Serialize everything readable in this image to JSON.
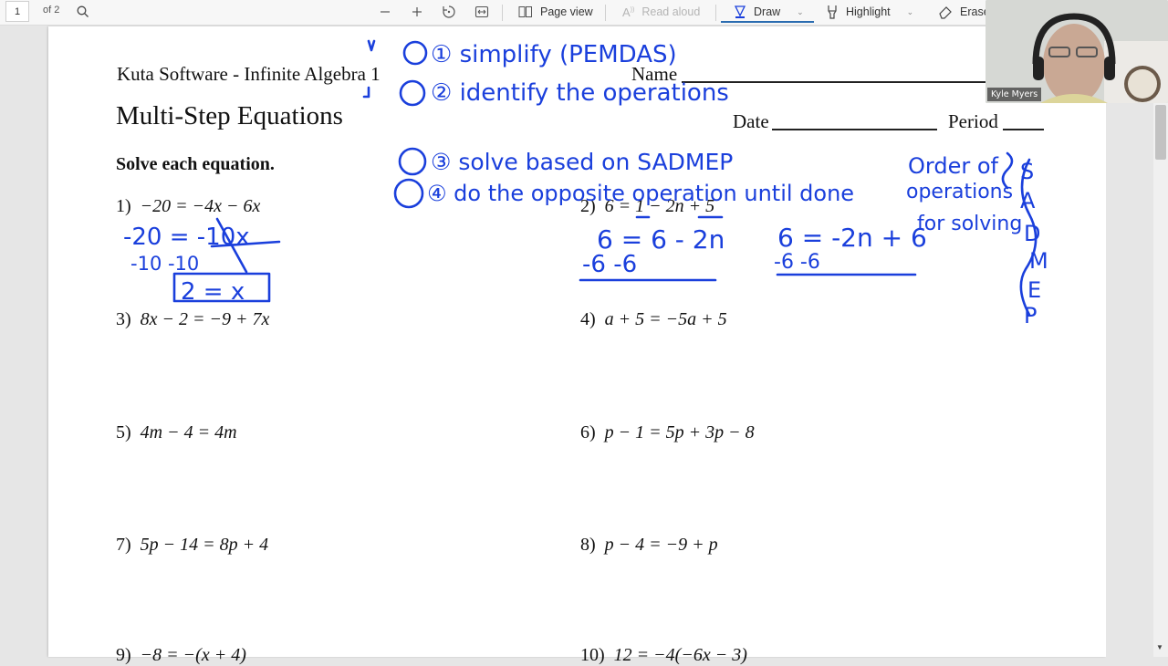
{
  "toolbar": {
    "page_number": "1",
    "page_total": "of 2",
    "buttons": {
      "page_view": "Page view",
      "read_aloud": "Read aloud",
      "draw": "Draw",
      "highlight": "Highlight",
      "erase": "Erase"
    },
    "icons": [
      "search-icon",
      "zoom-out-icon",
      "zoom-in-icon",
      "rotate-icon",
      "fit-width-icon"
    ]
  },
  "document": {
    "publisher": "Kuta Software - Infinite Algebra 1",
    "name_label": "Name",
    "title": "Multi-Step Equations",
    "date_label": "Date",
    "period_label": "Period",
    "instructions": "Solve each equation.",
    "problems": [
      {
        "num": "1)",
        "eq": "−20 = −4x − 6x"
      },
      {
        "num": "2)",
        "eq": "6 = 1 − 2n + 5"
      },
      {
        "num": "3)",
        "eq": "8x − 2 = −9 + 7x"
      },
      {
        "num": "4)",
        "eq": "a + 5 = −5a + 5"
      },
      {
        "num": "5)",
        "eq": "4m − 4 = 4m"
      },
      {
        "num": "6)",
        "eq": "p − 1 = 5p + 3p − 8"
      },
      {
        "num": "7)",
        "eq": "5p − 14 = 8p + 4"
      },
      {
        "num": "8)",
        "eq": "p − 4 = −9 + p"
      },
      {
        "num": "9)",
        "eq": "−8 = −(x + 4)"
      },
      {
        "num": "10)",
        "eq": "12 = −4(−6x − 3)"
      }
    ]
  },
  "annotations": {
    "steps": [
      "① simplify (PEMDAS)",
      "② identify the operations",
      "③ solve based on SADMEP",
      "④ do the opposite operation until done"
    ],
    "side_note": [
      "Order of",
      "operations",
      "for solving"
    ],
    "sadmep": [
      "S",
      "A",
      "D",
      "M",
      "E",
      "P"
    ],
    "work_p1": [
      "-20 = -10x",
      "-10    -10",
      "2 = x"
    ],
    "work_p2a": [
      "6 = 6 - 2n",
      "-6  -6"
    ],
    "work_p2b": [
      "6 = -2n + 6",
      "-6       -6"
    ],
    "ink_color": "#1a3fdc"
  },
  "webcam": {
    "participant_name": "Kyle Myers"
  },
  "colors": {
    "accent": "#2b6cb0",
    "toolbar_bg": "#f7f7f7",
    "viewer_bg": "#e6e6e6"
  }
}
